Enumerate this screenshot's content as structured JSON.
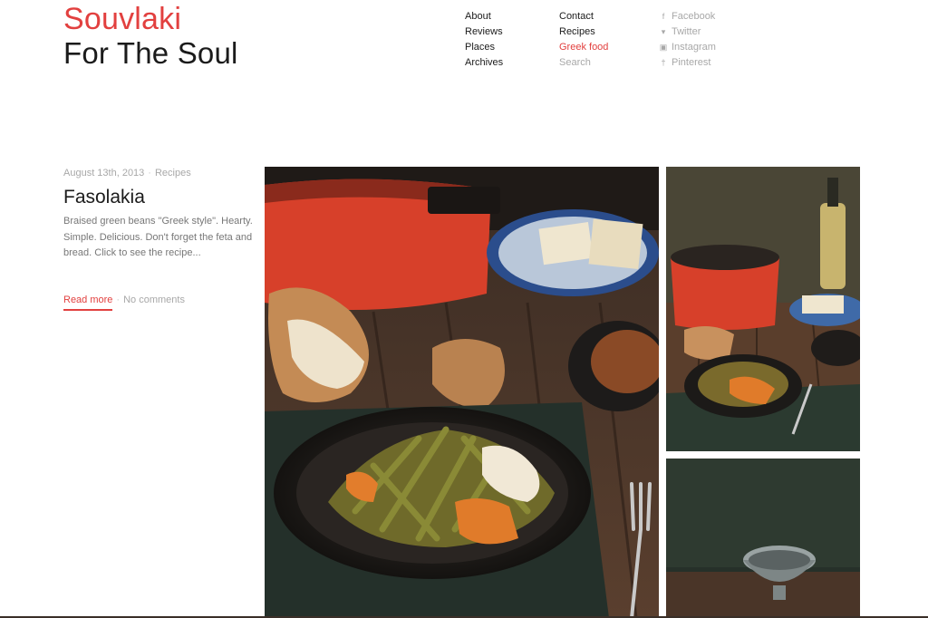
{
  "site": {
    "title_line1": "Souvlaki",
    "title_line2": "For The Soul"
  },
  "nav": {
    "col1": [
      "About",
      "Reviews",
      "Places",
      "Archives"
    ],
    "col2": [
      {
        "label": "Contact",
        "state": "normal"
      },
      {
        "label": "Recipes",
        "state": "normal"
      },
      {
        "label": "Greek food",
        "state": "active"
      },
      {
        "label": "Search",
        "state": "muted"
      }
    ],
    "social": [
      {
        "label": "Facebook",
        "icon": "facebook-icon"
      },
      {
        "label": "Twitter",
        "icon": "twitter-icon"
      },
      {
        "label": "Instagram",
        "icon": "instagram-icon"
      },
      {
        "label": "Pinterest",
        "icon": "pinterest-icon"
      }
    ]
  },
  "post": {
    "date": "August 13th, 2013",
    "category": "Recipes",
    "title": "Fasolakia",
    "excerpt": "Braised green beans \"Greek style\". Hearty. Simple. Delicious. Don't forget the feta and bread. Click to see the recipe...",
    "read_more": "Read more",
    "comments": "No comments"
  },
  "colors": {
    "accent": "#e2403f",
    "text": "#1b1b1b",
    "muted": "#a8a8a8"
  }
}
